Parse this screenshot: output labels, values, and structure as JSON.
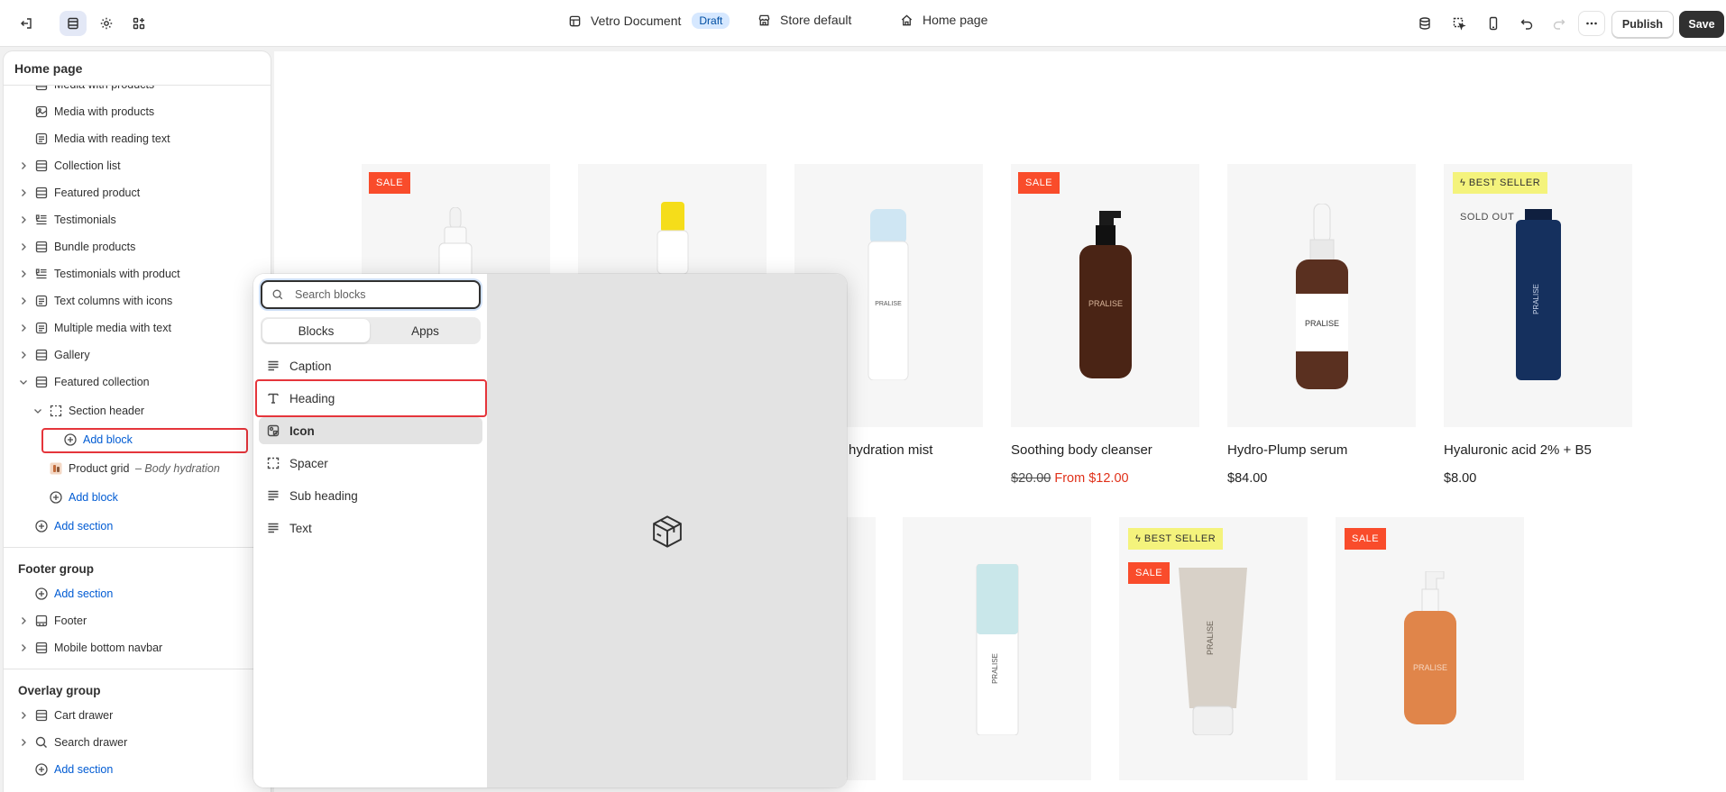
{
  "topbar": {
    "document_name": "Vetro Document",
    "draft_badge": "Draft",
    "store": "Store default",
    "page": "Home page",
    "publish_label": "Publish",
    "save_label": "Save"
  },
  "sidebar": {
    "title": "Home page",
    "sections": [
      {
        "label": "Media with products",
        "icon": "section-icon"
      },
      {
        "label": "Media with products",
        "icon": "image-icon"
      },
      {
        "label": "Media with reading text",
        "icon": "text-block-icon"
      },
      {
        "label": "Collection list",
        "icon": "section-icon"
      },
      {
        "label": "Featured product",
        "icon": "section-icon"
      },
      {
        "label": "Testimonials",
        "icon": "testimonial-icon"
      },
      {
        "label": "Bundle products",
        "icon": "section-icon"
      },
      {
        "label": "Testimonials with product",
        "icon": "testimonial-icon"
      },
      {
        "label": "Text columns with icons",
        "icon": "text-block-icon"
      },
      {
        "label": "Multiple media with text",
        "icon": "text-block-icon"
      },
      {
        "label": "Gallery",
        "icon": "section-icon"
      },
      {
        "label": "Featured collection",
        "icon": "section-icon"
      }
    ],
    "section_header": "Section header",
    "add_block": "Add block",
    "product_grid": "Product grid",
    "product_grid_note": "– Body hydration",
    "add_block_2": "Add block",
    "add_section": "Add section",
    "footer_group": {
      "title": "Footer group",
      "add_section": "Add section",
      "items": [
        "Footer",
        "Mobile bottom navbar"
      ]
    },
    "overlay_group": {
      "title": "Overlay group",
      "items": [
        "Cart drawer",
        "Search drawer"
      ],
      "add_section": "Add section"
    }
  },
  "block_picker": {
    "search_placeholder": "Search blocks",
    "tabs": [
      "Blocks",
      "Apps"
    ],
    "active_tab": "Blocks",
    "blocks": [
      "Caption",
      "Heading",
      "Icon",
      "Spacer",
      "Sub heading",
      "Text"
    ],
    "hovered_block": "Icon"
  },
  "canvas": {
    "products_row1": [
      {
        "name": "",
        "badge": "SALE",
        "price": ""
      },
      {
        "name": "",
        "badge": "",
        "price": ""
      },
      {
        "name": "hydration mist",
        "badge": "",
        "price": ""
      },
      {
        "name": "Soothing body cleanser",
        "badge": "SALE",
        "old_price": "$20.00",
        "price": "From $12.00"
      },
      {
        "name": "Hydro-Plump serum",
        "badge": "",
        "price": "$84.00"
      },
      {
        "name": "Hyaluronic acid 2% + B5",
        "badge": "BEST SELLER",
        "badge2": "SOLD OUT",
        "price": "$8.00"
      }
    ],
    "products_row2_badges": [
      "BEST SELLER",
      "SALE",
      "SALE"
    ],
    "bottle_label": "PRALISE"
  },
  "colors": {
    "accent_blue": "#005bd3",
    "sale_red": "#f94c2b",
    "best_yellow": "#f4f37c",
    "highlight_red": "#e5353b"
  }
}
